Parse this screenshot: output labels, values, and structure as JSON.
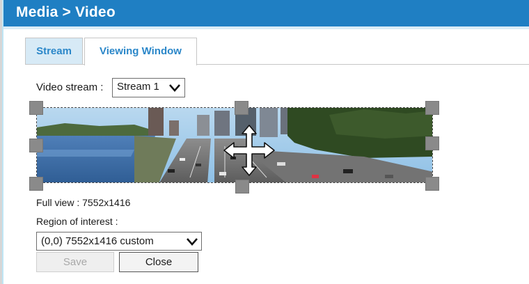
{
  "header": {
    "title": "Media  >  Video"
  },
  "tabs": [
    {
      "label": "Stream",
      "active": false
    },
    {
      "label": "Viewing Window",
      "active": true
    }
  ],
  "stream": {
    "label": "Video stream :",
    "selected": "Stream 1"
  },
  "preview": {
    "image_icon": "camera-preview-highway-river",
    "move_icon": "four-way-move-arrow-icon"
  },
  "full_view": {
    "text": "Full view : 7552x1416"
  },
  "roi": {
    "label": "Region of interest :",
    "selected": "(0,0) 7552x1416 custom"
  },
  "buttons": {
    "save_label": "Save",
    "save_disabled": true,
    "close_label": "Close"
  },
  "colors": {
    "header_bg": "#1f7fc3",
    "tab_active_text": "#2b87c9",
    "tab_inactive_bg": "#d7eaf6"
  }
}
